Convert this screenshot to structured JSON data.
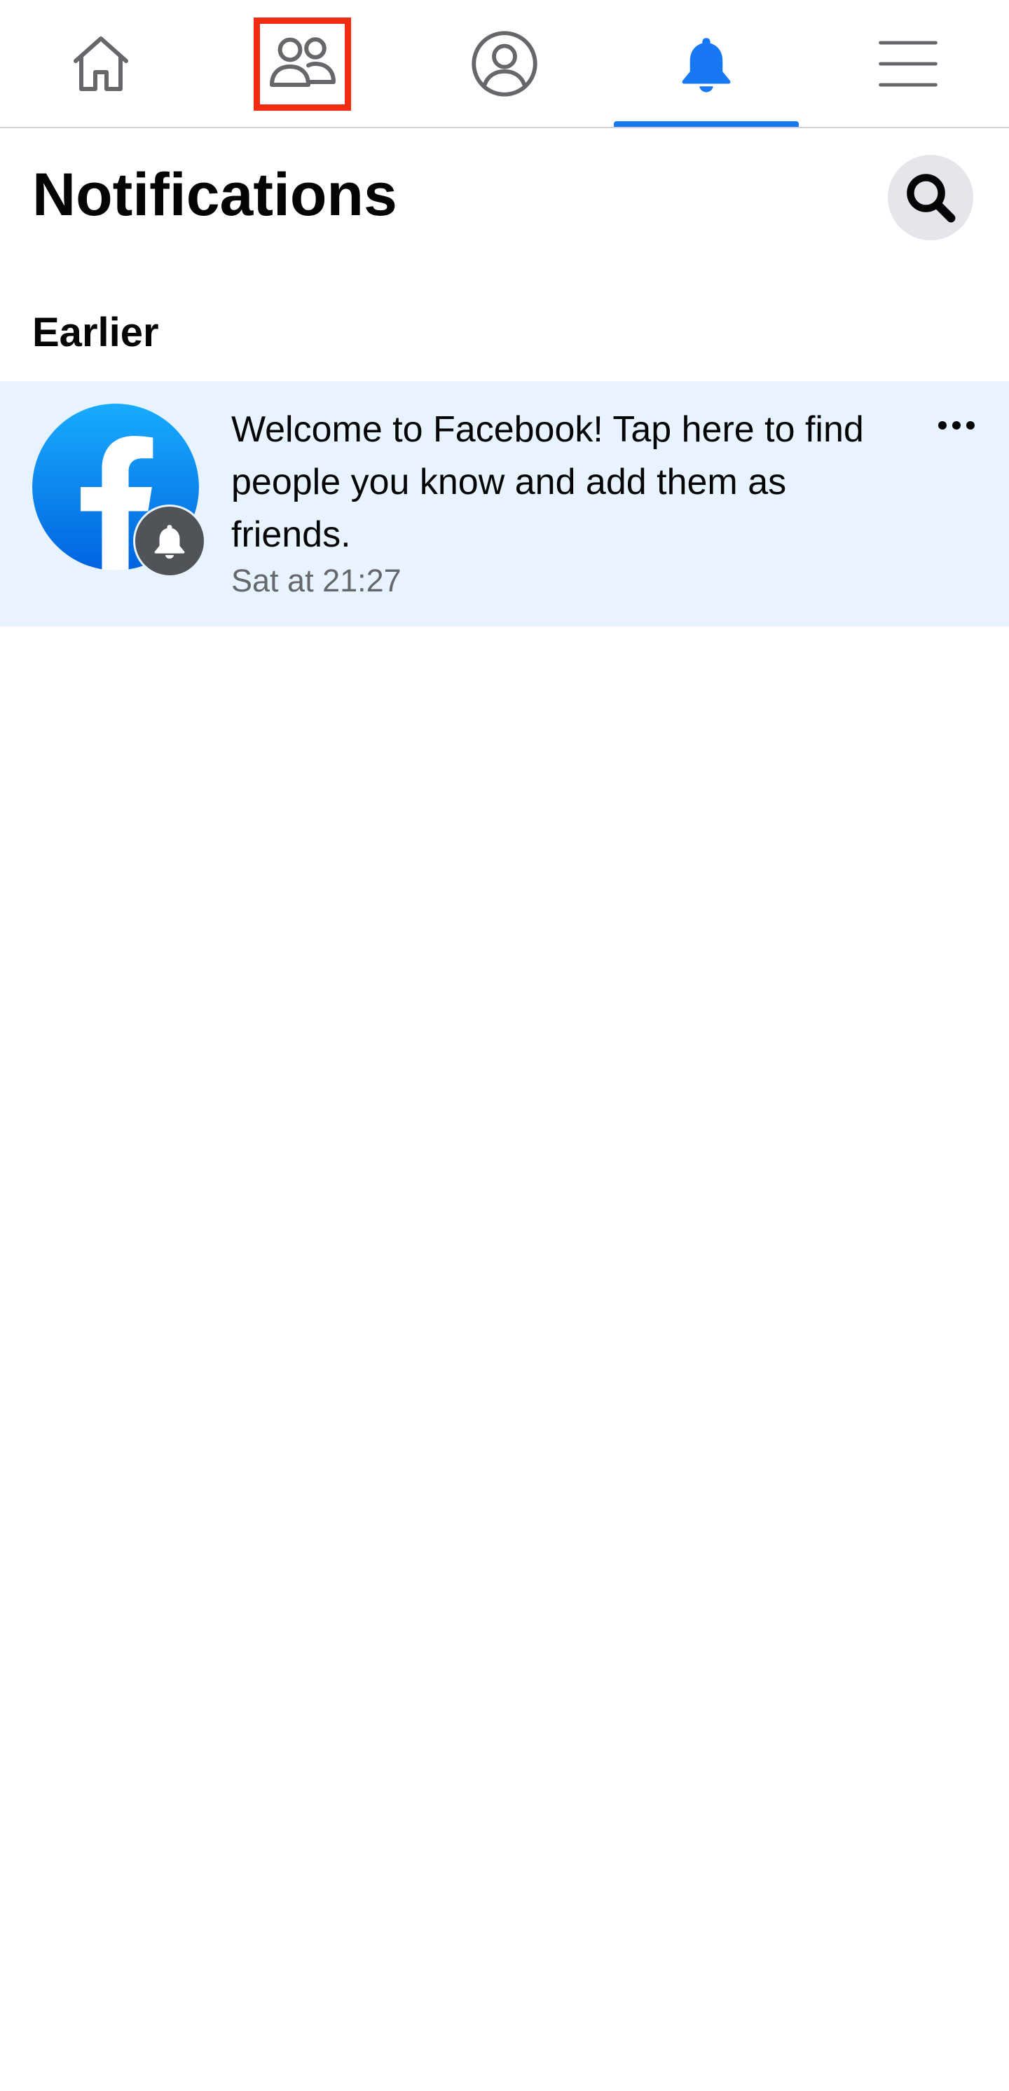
{
  "colors": {
    "accent": "#1877f2",
    "nav_icon": "#65676b",
    "notification_bg": "#e7f3ff",
    "highlight": "#f22c12",
    "search_bg": "#e4e6eb"
  },
  "nav": {
    "tabs": [
      {
        "icon": "home-icon",
        "active": false
      },
      {
        "icon": "friends-icon",
        "active": false,
        "highlighted": true
      },
      {
        "icon": "profile-icon",
        "active": false
      },
      {
        "icon": "bell-icon",
        "active": true
      },
      {
        "icon": "menu-icon",
        "active": false
      }
    ]
  },
  "header": {
    "title": "Notifications",
    "search_icon": "search-icon"
  },
  "sections": [
    {
      "title": "Earlier",
      "notifications": [
        {
          "avatar_icon": "facebook-logo",
          "badge_icon": "bell-icon",
          "text": "Welcome to Facebook! Tap here to find people you know and add them as friends.",
          "time": "Sat at 21:27",
          "unread": true,
          "more_icon": "more-dots-icon"
        }
      ]
    }
  ]
}
